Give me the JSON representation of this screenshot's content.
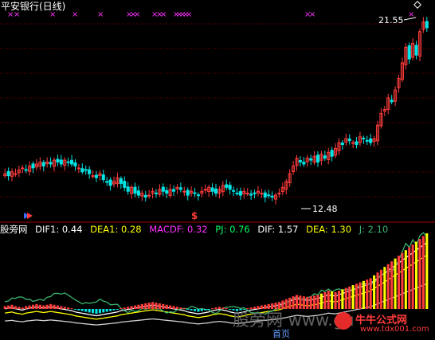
{
  "window": {
    "title": "平安银行(日线)",
    "indicator_name": "股旁网",
    "colors": {
      "background": "#000000",
      "up": "#ff3c3c",
      "down": "#00e5e5",
      "grid": "#7a0000",
      "dif1": "#ffffff",
      "dea1": "#ffff00",
      "macdf": "#ff33ff",
      "pj": "#00ff66",
      "dif": "#ffffff",
      "dea": "#ffff00",
      "j": "#3cb371"
    }
  },
  "price_panel": {
    "high_label": "21.55",
    "low_label": "12.48",
    "signal_glyph": "$",
    "x_marker_glyph": "×"
  },
  "indicator_header": {
    "dif1": "DIF1: 0.44",
    "dea1": "DEA1: 0.28",
    "macdf": "MACDF: 0.32",
    "pj": "PJ: 0.76",
    "dif": "DIF: 1.57",
    "dea": "DEA: 1.30",
    "j": "J: 2.10"
  },
  "watermark": {
    "main": "股旁网 www.gu",
    "sub": "首页",
    "site_cn": "牛牛公式网",
    "site_url": "www.tdx001.com"
  },
  "chart_data": {
    "type": "candlestick",
    "price_range": [
      11.5,
      22.3
    ],
    "close": [
      13.7,
      13.6,
      13.8,
      13.7,
      13.9,
      14.0,
      13.9,
      14.1,
      14.0,
      14.2,
      14.3,
      14.1,
      14.3,
      14.2,
      14.4,
      14.3,
      14.2,
      14.4,
      14.3,
      14.2,
      14.1,
      14.0,
      13.8,
      13.9,
      13.7,
      13.6,
      13.5,
      13.7,
      13.4,
      13.3,
      13.1,
      13.3,
      13.5,
      13.2,
      13.0,
      12.8,
      13.0,
      12.7,
      12.6,
      12.7,
      12.5,
      12.6,
      12.8,
      12.7,
      12.9,
      12.8,
      12.7,
      12.9,
      12.8,
      13.0,
      12.9,
      12.8,
      12.6,
      12.8,
      12.7,
      12.6,
      12.8,
      12.9,
      13.0,
      12.8,
      12.7,
      12.9,
      13.1,
      13.0,
      12.9,
      12.8,
      12.7,
      12.6,
      12.8,
      12.7,
      12.6,
      12.7,
      12.8,
      12.7,
      12.5,
      12.6,
      12.5,
      12.6,
      12.7,
      13.0,
      13.3,
      13.7,
      14.1,
      14.5,
      14.3,
      14.2,
      14.5,
      14.4,
      14.6,
      14.3,
      14.7,
      14.5,
      14.8,
      14.6,
      15.0,
      15.3,
      15.2,
      15.5,
      15.4,
      15.3,
      15.2,
      15.6,
      15.5,
      15.4,
      15.3,
      15.5,
      16.2,
      16.8,
      17.0,
      17.6,
      17.4,
      18.0,
      18.6,
      19.4,
      20.2,
      19.6,
      20.4,
      19.8,
      21.0,
      21.5,
      21.2
    ],
    "macd_hist": [
      0.2,
      0.25,
      0.3,
      0.2,
      0.15,
      0.1,
      0.2,
      0.25,
      0.3,
      0.35,
      0.3,
      0.25,
      0.3,
      0.35,
      0.3,
      0.25,
      0.2,
      0.15,
      0.1,
      0.05,
      -0.05,
      -0.1,
      -0.15,
      -0.2,
      -0.25,
      -0.3,
      -0.35,
      -0.3,
      -0.25,
      -0.2,
      -0.15,
      -0.1,
      -0.05,
      0.05,
      0.1,
      0.15,
      0.2,
      0.25,
      0.3,
      0.35,
      0.4,
      0.45,
      0.5,
      0.45,
      0.4,
      0.35,
      0.3,
      0.25,
      0.2,
      0.15,
      0.1,
      0.05,
      -0.05,
      -0.1,
      -0.15,
      -0.2,
      -0.15,
      -0.1,
      -0.05,
      0.05,
      0.1,
      0.15,
      0.1,
      0.05,
      -0.05,
      -0.1,
      -0.15,
      -0.1,
      -0.05,
      0.05,
      0.1,
      0.15,
      0.2,
      0.25,
      0.3,
      0.35,
      0.4,
      0.45,
      0.5,
      0.6,
      0.7,
      0.8,
      0.9,
      1.0,
      0.95,
      0.9,
      0.85,
      0.9,
      0.95,
      1.0,
      1.1,
      1.2,
      1.3,
      1.25,
      1.2,
      1.3,
      1.4,
      1.5,
      1.6,
      1.7,
      1.8,
      1.9,
      2.0,
      2.1,
      2.2,
      2.4,
      2.6,
      2.8,
      3.0,
      3.2,
      3.4,
      3.6,
      3.8,
      4.0,
      4.2,
      4.4,
      4.6,
      4.8,
      5.0,
      5.2,
      5.4
    ]
  }
}
